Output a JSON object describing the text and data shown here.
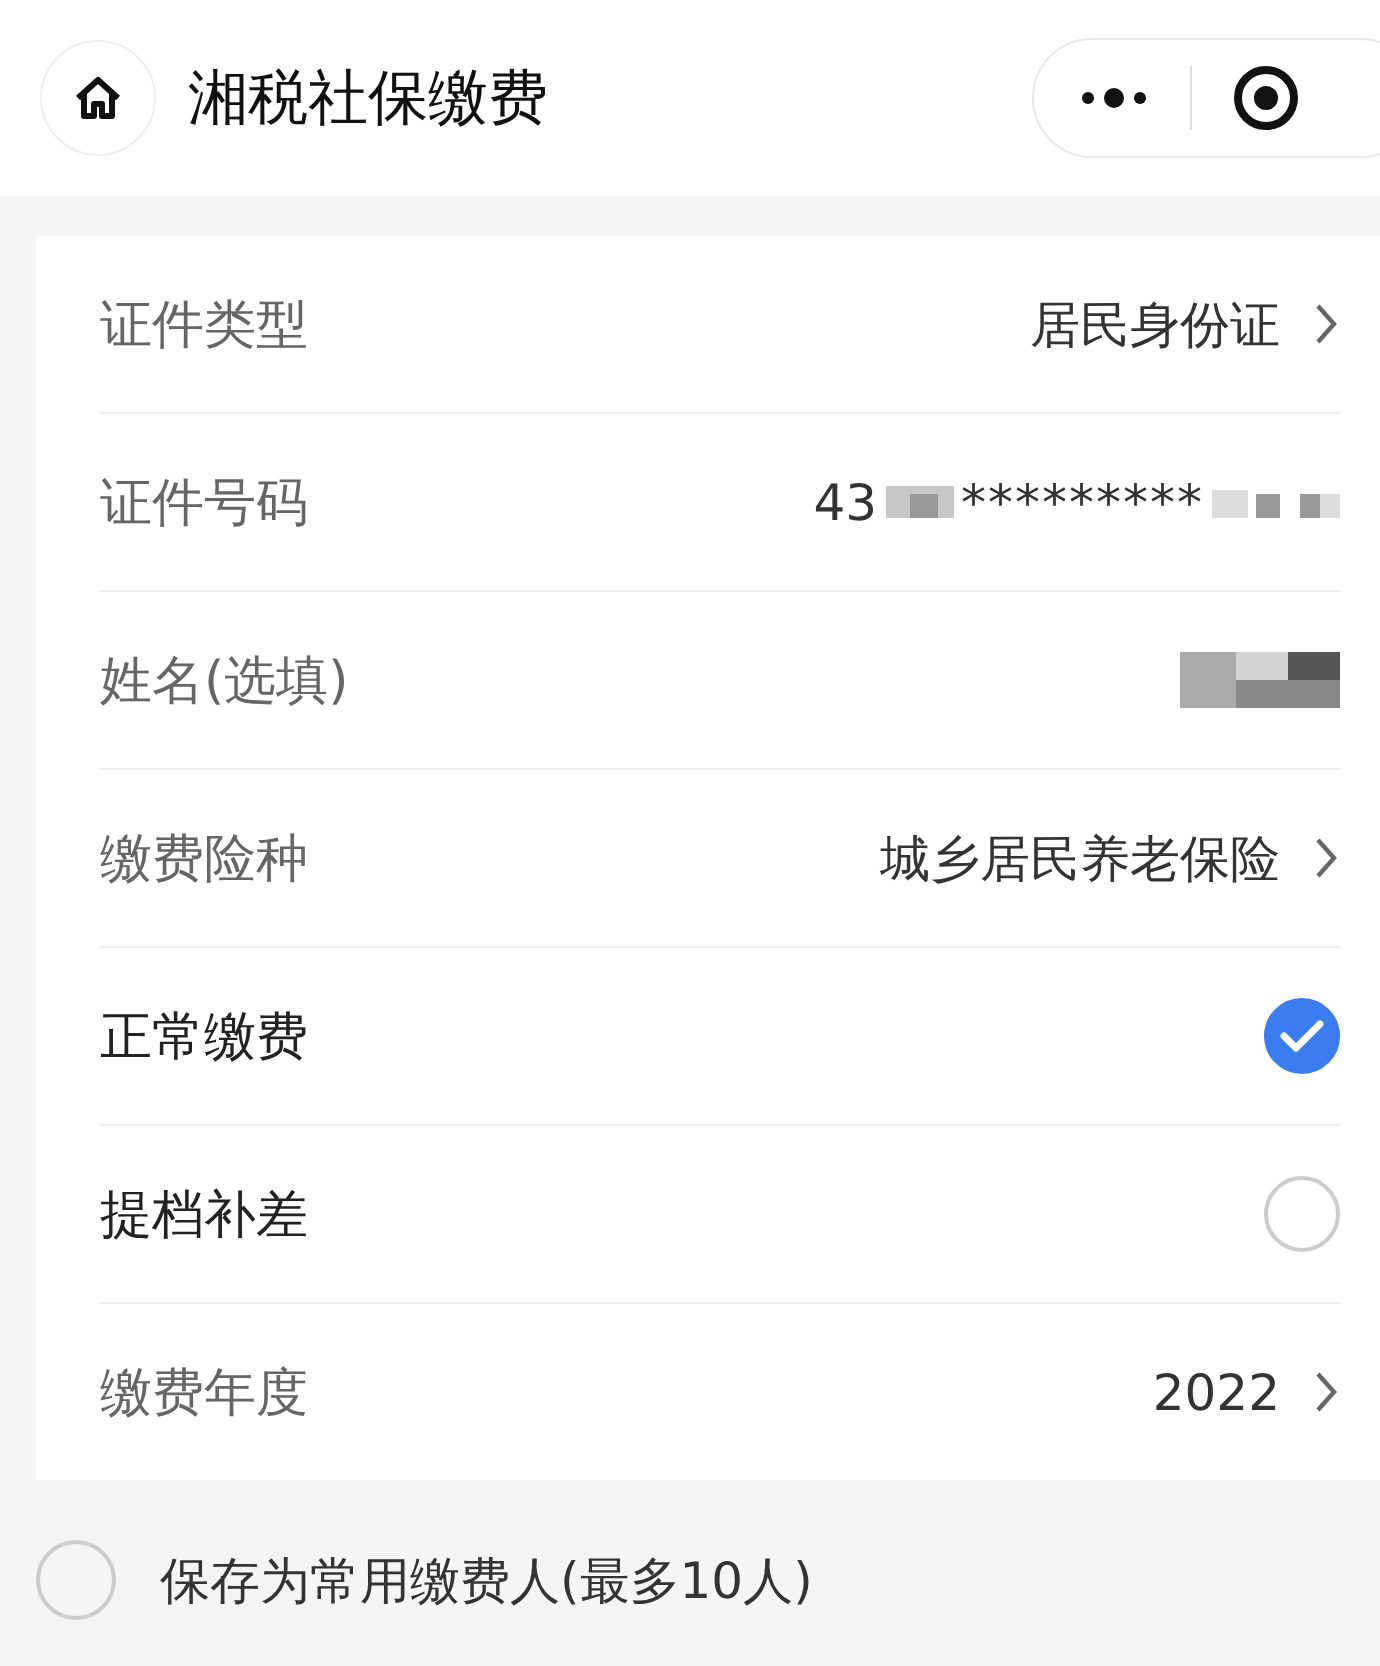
{
  "header": {
    "title": "湘税社保缴费"
  },
  "rows": [
    {
      "kind": "select",
      "label": "证件类型",
      "value": "居民身份证"
    },
    {
      "kind": "idnumber",
      "label": "证件号码",
      "prefix": "43",
      "masked": "*********"
    },
    {
      "kind": "redacted",
      "label": "姓名(选填)"
    },
    {
      "kind": "select",
      "label": "缴费险种",
      "value": "城乡居民养老保险"
    },
    {
      "kind": "radio",
      "label": "正常缴费",
      "selected": true
    },
    {
      "kind": "radio",
      "label": "提档补差",
      "selected": false
    },
    {
      "kind": "select",
      "label": "缴费年度",
      "value": "2022"
    }
  ],
  "save": {
    "label": "保存为常用缴费人(最多10人)",
    "checked": false
  }
}
